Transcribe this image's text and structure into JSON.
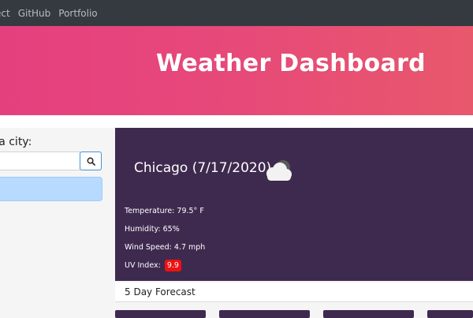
{
  "navbar": {
    "links": [
      "ect",
      "GitHub",
      "Portfolio"
    ]
  },
  "hero": {
    "title": "Weather Dashboard"
  },
  "sidebar": {
    "label": "r a city:",
    "search_value": "",
    "search_icon": "search-icon"
  },
  "current": {
    "heading": "Chicago (7/17/2020)",
    "icon": "cloudy-icon",
    "temperature": "Temperature: 79.5° F",
    "humidity": "Humidity: 65%",
    "wind": "Wind Speed: 4.7 mph",
    "uv_label": "UV Index:",
    "uv_value": "9.9",
    "uv_color": "#ee1111"
  },
  "forecast": {
    "title": "5 Day Forecast"
  },
  "colors": {
    "navbar": "#343a40",
    "hero_start": "#e5407e",
    "hero_end": "#e8586c",
    "card": "#3f2a4f",
    "results_bg": "#b8daff"
  }
}
